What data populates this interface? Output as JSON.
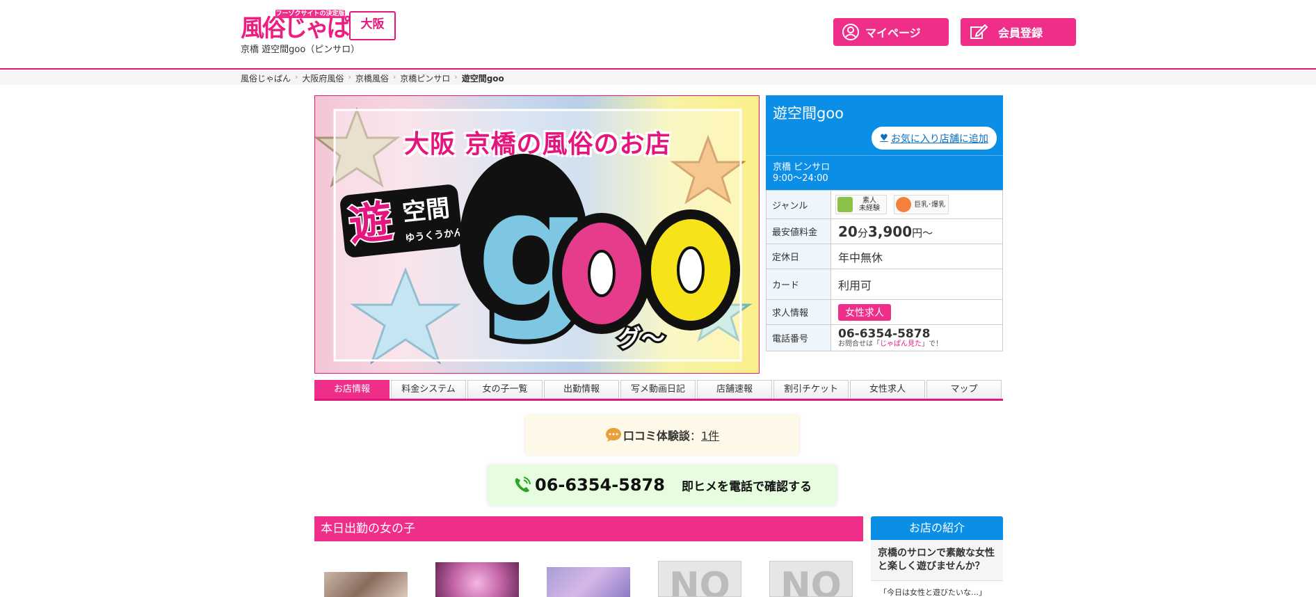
{
  "header": {
    "logo_sub": "フーゾクサイトの決定版",
    "logo_text": "風俗じゃぱん!",
    "region": "大阪",
    "subtitle": "京橋 遊空間goo（ピンサロ）",
    "mypage_label": "マイページ",
    "register_label": "会員登録"
  },
  "breadcrumb": {
    "items": [
      "風俗じゃぱん",
      "大阪府風俗",
      "京橋風俗",
      "京橋ピンサロ",
      "遊空間goo"
    ]
  },
  "banner": {
    "title": "大阪 京橋の風俗のお店",
    "logo_kanji_1": "遊",
    "logo_kanji_2": "空間",
    "logo_reading": "ゆうくうかん",
    "logo_g": "g",
    "logo_o": "o",
    "logo_kana": "グ〜"
  },
  "info": {
    "shop_name": "遊空間goo",
    "favorite_label": "お気に入り店舗に追加",
    "genre_area": "京橋 ピンサロ",
    "hours": "9:00〜24:00",
    "rows": {
      "genre_label": "ジャンル",
      "genre_chip_1": "素人\n未経験",
      "genre_chip_2": "巨乳･爆乳",
      "price_label": "最安値料金",
      "price_minutes": "20",
      "price_minutes_unit": "分",
      "price_amount": "3,900",
      "price_unit": "円〜",
      "holiday_label": "定休日",
      "holiday_value": "年中無休",
      "card_label": "カード",
      "card_value": "利用可",
      "recruit_label": "求人情報",
      "recruit_value": "女性求人",
      "phone_label": "電話番号",
      "phone_value": "06-6354-5878",
      "phone_note_pre": "お問合せは「",
      "phone_note_pink": "じゃぱん見た",
      "phone_note_post": "」で！"
    }
  },
  "tabs": [
    "お店情報",
    "料金システム",
    "女の子一覧",
    "出勤情報",
    "写メ動画日記",
    "店舗速報",
    "割引チケット",
    "女性求人",
    "マップ"
  ],
  "review": {
    "label": "口コミ体験談",
    "colon": "：",
    "count": "1件"
  },
  "phone_cta": {
    "number": "06-6354-5878",
    "message": "即ヒメを電話で確認する"
  },
  "today": {
    "heading": "本日出勤の女の子",
    "noimage_text": "NO"
  },
  "intro": {
    "heading": "お店の紹介",
    "catch": "京橋のサロンで素敵な女性と楽しく遊びませんか？",
    "quote": "「今日は女性と遊びたいな…」"
  },
  "colors": {
    "pink": "#ee2e88",
    "blue": "#0b8ee6",
    "review_bg": "#fdf8e7",
    "phone_bg": "#e7fde0"
  }
}
